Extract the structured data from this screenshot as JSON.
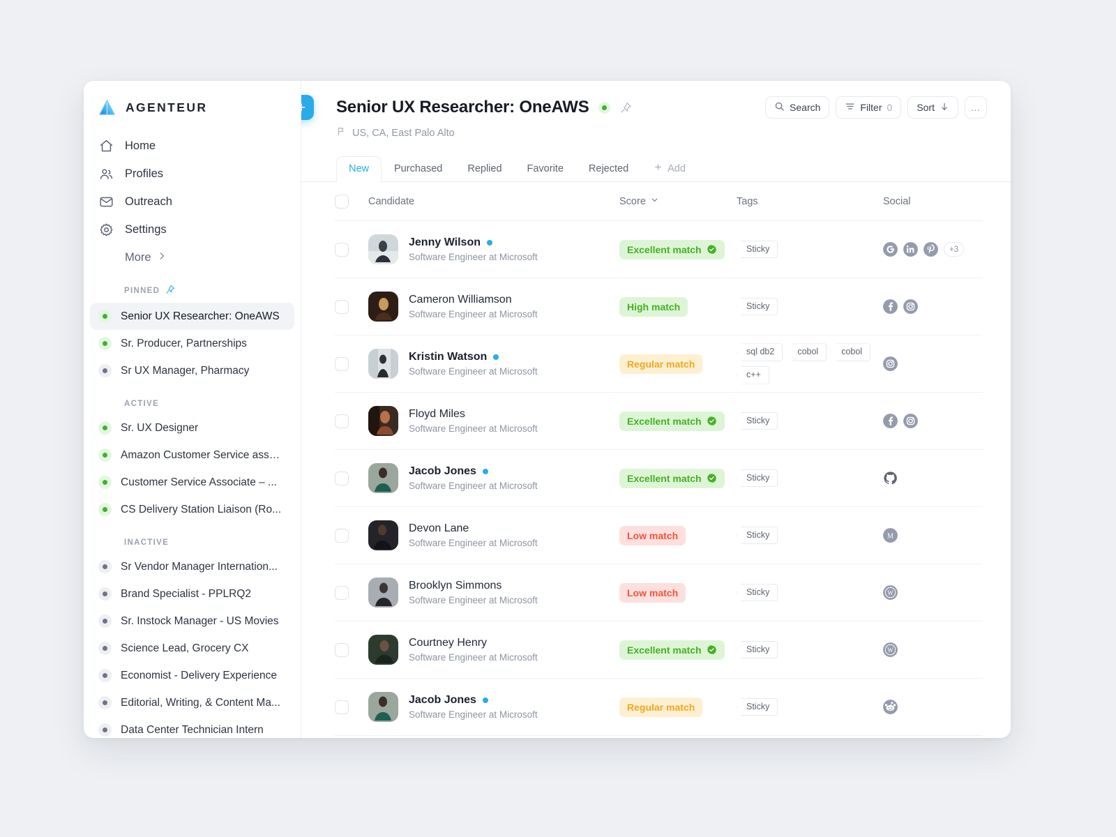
{
  "brand": {
    "name": "AGENTEUR",
    "logo_icon": "triangle-logo-icon"
  },
  "sidebar": {
    "nav": [
      {
        "label": "Home",
        "icon": "home-icon"
      },
      {
        "label": "Profiles",
        "icon": "users-icon"
      },
      {
        "label": "Outreach",
        "icon": "envelope-icon"
      },
      {
        "label": "Settings",
        "icon": "gear-icon"
      }
    ],
    "more_label": "More",
    "sections": [
      {
        "title": "PINNED",
        "icon": "pin-icon",
        "items": [
          {
            "label": "Senior UX Researcher: OneAWS",
            "status": "green",
            "active": true
          },
          {
            "label": "Sr. Producer, Partnerships",
            "status": "green",
            "active": false
          },
          {
            "label": "Sr UX Manager, Pharmacy",
            "status": "grey",
            "active": false
          }
        ]
      },
      {
        "title": "ACTIVE",
        "icon": "",
        "items": [
          {
            "label": "Sr. UX Designer",
            "status": "green",
            "active": false
          },
          {
            "label": "Amazon Customer Service asso...",
            "status": "green",
            "active": false
          },
          {
            "label": "Customer Service Associate – ...",
            "status": "green",
            "active": false
          },
          {
            "label": "CS Delivery Station Liaison (Ro...",
            "status": "green",
            "active": false
          }
        ]
      },
      {
        "title": "INACTIVE",
        "icon": "",
        "items": [
          {
            "label": "Sr Vendor Manager Internation...",
            "status": "grey",
            "active": false
          },
          {
            "label": "Brand Specialist - PPLRQ2",
            "status": "grey",
            "active": false
          },
          {
            "label": "Sr. Instock Manager - US Movies",
            "status": "grey",
            "active": false
          },
          {
            "label": "Science Lead, Grocery CX",
            "status": "grey",
            "active": false
          },
          {
            "label": "Economist - Delivery Experience",
            "status": "grey",
            "active": false
          },
          {
            "label": "Editorial, Writing, & Content Ma...",
            "status": "grey",
            "active": false
          },
          {
            "label": "Data Center Technician Intern",
            "status": "grey",
            "active": false
          }
        ]
      }
    ]
  },
  "header": {
    "add_button_label": "+",
    "title": "Senior UX Researcher: OneAWS",
    "status_dot": "green",
    "pin_icon": "pin-icon",
    "location": "US, CA, East Palo Alto",
    "location_icon": "flag-icon",
    "actions": [
      {
        "label": "Search",
        "icon": "search-icon",
        "count": ""
      },
      {
        "label": "Filter",
        "icon": "filter-icon",
        "count": "0"
      },
      {
        "label": "Sort",
        "icon": "arrow-down-icon",
        "count": ""
      },
      {
        "label": "…",
        "icon": "ellipsis-icon",
        "count": ""
      }
    ]
  },
  "tabs": [
    {
      "label": "New",
      "active": true
    },
    {
      "label": "Purchased",
      "active": false
    },
    {
      "label": "Replied",
      "active": false
    },
    {
      "label": "Favorite",
      "active": false
    },
    {
      "label": "Rejected",
      "active": false
    },
    {
      "label": "Add",
      "active": false,
      "is_add": true
    }
  ],
  "table": {
    "columns": [
      {
        "label": "Candidate",
        "sortable": false
      },
      {
        "label": "Score",
        "sortable": true
      },
      {
        "label": "Tags",
        "sortable": false
      },
      {
        "label": "Social",
        "sortable": false
      }
    ],
    "rows": [
      {
        "name": "Jenny Wilson",
        "bold": true,
        "new": true,
        "role": "Software Engineer at Microsoft",
        "score": "Excellent match",
        "score_type": "excellent",
        "verified": true,
        "tags": [
          "Sticky"
        ],
        "socials": [
          "google",
          "linkedin",
          "pinterest"
        ],
        "more_socials": "+3",
        "avatar": "photo-light"
      },
      {
        "name": "Cameron Williamson",
        "bold": false,
        "new": false,
        "role": "Software Engineer at Microsoft",
        "score": "High match",
        "score_type": "high",
        "verified": false,
        "tags": [
          "Sticky"
        ],
        "socials": [
          "facebook",
          "instagram"
        ],
        "more_socials": "",
        "avatar": "photo-dark"
      },
      {
        "name": "Kristin Watson",
        "bold": true,
        "new": true,
        "role": "Software Engineer at Microsoft",
        "score": "Regular match",
        "score_type": "regular",
        "verified": false,
        "tags": [
          "sql db2",
          "cobol",
          "cobol",
          "c++"
        ],
        "socials": [
          "instagram"
        ],
        "more_socials": "",
        "avatar": "photo-light"
      },
      {
        "name": "Floyd Miles",
        "bold": false,
        "new": false,
        "role": "Software Engineer at Microsoft",
        "score": "Excellent match",
        "score_type": "excellent",
        "verified": true,
        "tags": [
          "Sticky"
        ],
        "socials": [
          "facebook",
          "instagram"
        ],
        "more_socials": "",
        "avatar": "photo-warm"
      },
      {
        "name": "Jacob Jones",
        "bold": true,
        "new": true,
        "role": "Software Engineer at Microsoft",
        "score": "Excellent match",
        "score_type": "excellent",
        "verified": true,
        "tags": [
          "Sticky"
        ],
        "socials": [
          "github"
        ],
        "more_socials": "",
        "avatar": "photo-green"
      },
      {
        "name": "Devon Lane",
        "bold": false,
        "new": false,
        "role": "Software Engineer at Microsoft",
        "score": "Low match",
        "score_type": "low",
        "verified": false,
        "tags": [
          "Sticky"
        ],
        "socials": [
          "medium"
        ],
        "more_socials": "",
        "avatar": "photo-dark"
      },
      {
        "name": "Brooklyn Simmons",
        "bold": false,
        "new": false,
        "role": "Software Engineer at Microsoft",
        "score": "Low match",
        "score_type": "low",
        "verified": false,
        "tags": [
          "Sticky"
        ],
        "socials": [
          "wordpress"
        ],
        "more_socials": "",
        "avatar": "photo-grey"
      },
      {
        "name": "Courtney Henry",
        "bold": false,
        "new": false,
        "role": "Software Engineer at Microsoft",
        "score": "Excellent match",
        "score_type": "excellent",
        "verified": true,
        "tags": [
          "Sticky"
        ],
        "socials": [
          "wordpress"
        ],
        "more_socials": "",
        "avatar": "photo-dark"
      },
      {
        "name": "Jacob Jones",
        "bold": true,
        "new": true,
        "role": "Software Engineer at Microsoft",
        "score": "Regular match",
        "score_type": "regular",
        "verified": false,
        "tags": [
          "Sticky"
        ],
        "socials": [
          "reddit"
        ],
        "more_socials": "",
        "avatar": "photo-green"
      }
    ]
  },
  "colors": {
    "accent": "#29abe8",
    "green": "#45b025",
    "green_bg": "#ddf5d6",
    "amber": "#f0a821",
    "amber_bg": "#fdf0d2",
    "red": "#f2553d",
    "red_bg": "#fde0dd",
    "page_bg": "#eef0f3",
    "social_grey": "#949bad"
  }
}
